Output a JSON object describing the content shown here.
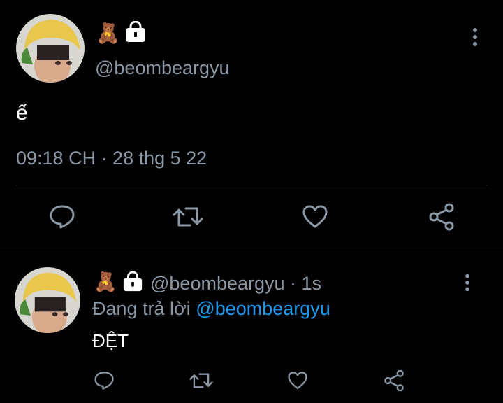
{
  "main_tweet": {
    "avatar_alt": "profile picture",
    "name_emoji": "🧸",
    "handle": "@beombeargyu",
    "text": "ế",
    "timestamp": "09:18 CH · 28 thg 5 22",
    "icons": [
      "lock-icon",
      "more-vertical-icon",
      "reply-icon",
      "retweet-icon",
      "like-icon",
      "share-icon"
    ]
  },
  "reply_tweet": {
    "name_emoji": "🧸",
    "handle": "@beombeargyu",
    "time": "· 1s",
    "replying_prefix": "Đang trả lời",
    "replying_to": "@beombeargyu",
    "text": "ĐỆT",
    "icons": [
      "lock-icon",
      "more-vertical-icon",
      "reply-icon",
      "retweet-icon",
      "like-icon",
      "share-icon"
    ]
  },
  "colors": {
    "background": "#000000",
    "muted_text": "#8b98a5",
    "link": "#1d9bf0",
    "divider": "#2f3336"
  }
}
